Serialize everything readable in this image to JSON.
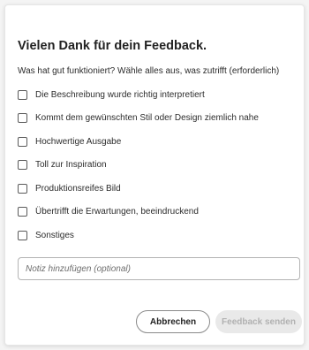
{
  "dialog": {
    "title": "Vielen Dank für dein Feedback.",
    "question": "Was hat gut funktioniert? Wähle alles aus, was zutrifft (erforderlich)",
    "options": [
      {
        "label": "Die Beschreibung wurde richtig interpretiert",
        "checked": false
      },
      {
        "label": "Kommt dem gewünschten Stil oder Design ziemlich nahe",
        "checked": false
      },
      {
        "label": "Hochwertige Ausgabe",
        "checked": false
      },
      {
        "label": "Toll zur Inspiration",
        "checked": false
      },
      {
        "label": "Produktionsreifes Bild",
        "checked": false
      },
      {
        "label": "Übertrifft die Erwartungen, beeindruckend",
        "checked": false
      },
      {
        "label": "Sonstiges",
        "checked": false
      }
    ],
    "note": {
      "value": "",
      "placeholder": "Notiz hinzufügen (optional)"
    },
    "buttons": {
      "cancel_label": "Abbrechen",
      "send_label": "Feedback senden",
      "send_disabled": true
    }
  },
  "colors": {
    "text": "#2c2c2c",
    "title": "#222222",
    "disabled_bg": "#e9e9e9",
    "disabled_text": "#b1b1b1",
    "border": "#8a8a8a"
  }
}
